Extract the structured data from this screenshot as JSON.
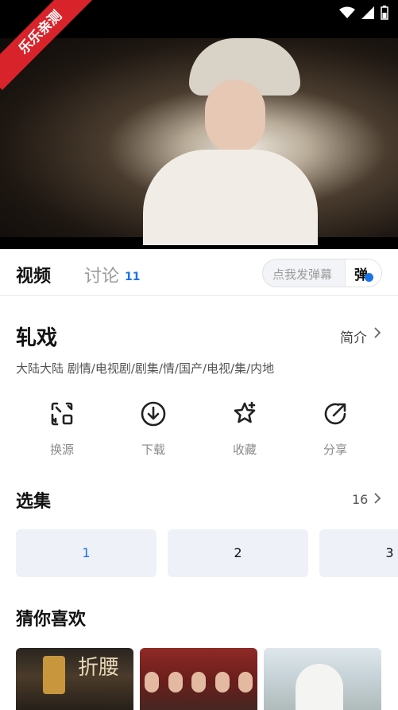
{
  "player": {
    "watermark": "乐乐亲测",
    "back_icon": "chevron-left-icon",
    "status_icons": [
      "wifi-icon",
      "signal-icon",
      "battery-icon"
    ]
  },
  "tabs": {
    "video_label": "视频",
    "discuss_label": "讨论",
    "discuss_count": "11",
    "danmaku_placeholder": "点我发弹幕",
    "danmaku_button": "弹"
  },
  "show": {
    "title": "轧戏",
    "intro_label": "简介",
    "meta": "大陆大陆  剧情/电视剧/剧集/情/国产/电视/集/内地"
  },
  "actions": [
    {
      "label": "换源",
      "icon": "switch-source-icon"
    },
    {
      "label": "下载",
      "icon": "download-icon"
    },
    {
      "label": "收藏",
      "icon": "star-add-icon"
    },
    {
      "label": "分享",
      "icon": "share-icon"
    }
  ],
  "episodes": {
    "title": "选集",
    "count": "16",
    "items": [
      "1",
      "2",
      "3"
    ],
    "selected": "1"
  },
  "recommend": {
    "title": "猜你喜欢",
    "rec1_text": "折腰"
  },
  "colors": {
    "accent": "#1a73e8",
    "episode_bg": "#eef1f8",
    "watermark": "#d8232a"
  }
}
